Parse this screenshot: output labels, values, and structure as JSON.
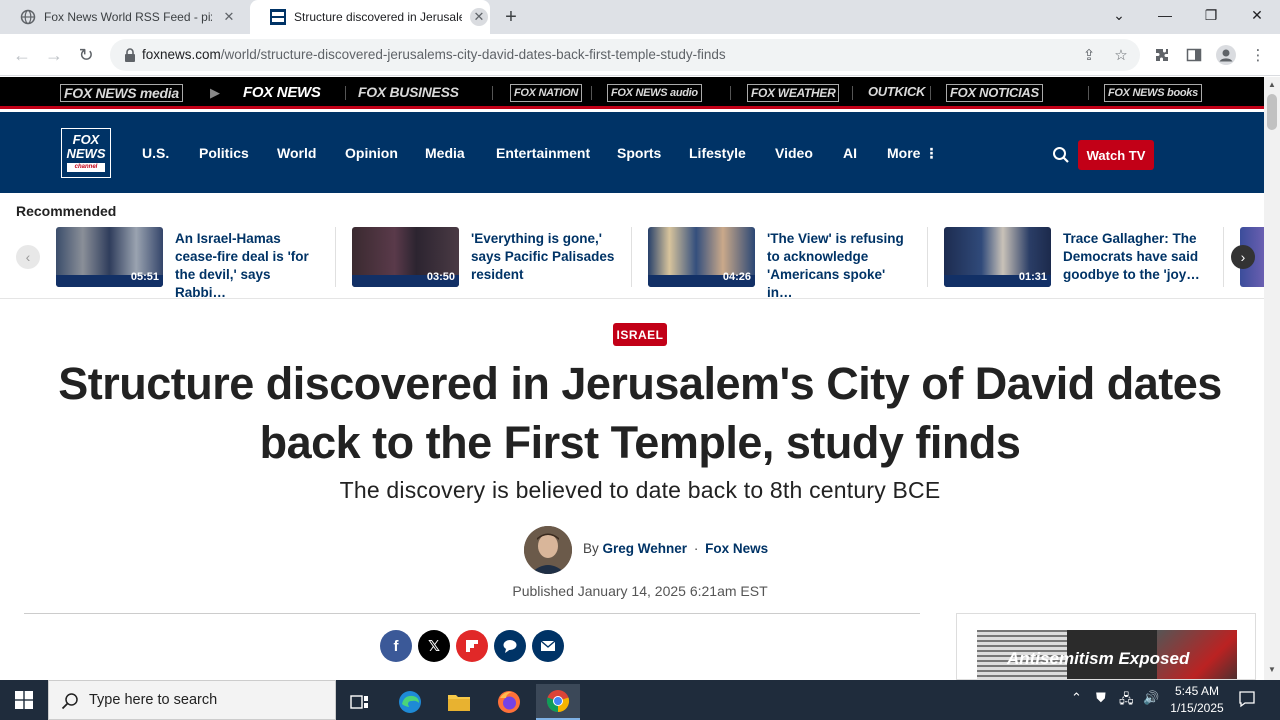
{
  "browser": {
    "tabs": [
      {
        "title": "Fox News World RSS Feed - pixm",
        "close": "✕"
      },
      {
        "title": "Structure discovered in Jerusalem",
        "close": "✕"
      }
    ],
    "new_tab": "+",
    "url_host": "foxnews.com",
    "url_path": "/world/structure-discovered-jerusalems-city-david-dates-back-first-temple-study-finds"
  },
  "brands": [
    "FOX NEWS media",
    "FOX NEWS",
    "FOX BUSINESS",
    "FOX NATION",
    "FOX NEWS audio",
    "FOX WEATHER",
    "OUTKICK",
    "FOX NOTICIAS",
    "FOX NEWS books"
  ],
  "logo": {
    "line1": "FOX",
    "line2": "NEWS",
    "line3": "channel"
  },
  "nav": {
    "items": [
      "U.S.",
      "Politics",
      "World",
      "Opinion",
      "Media",
      "Entertainment",
      "Sports",
      "Lifestyle",
      "Video",
      "AI",
      "More"
    ],
    "watch_tv": "Watch TV"
  },
  "recommended": {
    "title": "Recommended",
    "items": [
      {
        "duration": "05:51",
        "text": "An Israel-Hamas cease-fire deal is 'for the devil,' says Rabbi…"
      },
      {
        "duration": "03:50",
        "text": "'Everything is gone,' says Pacific Palisades resident"
      },
      {
        "duration": "04:26",
        "text": "'The View' is refusing to acknowledge 'Americans spoke' in…"
      },
      {
        "duration": "01:31",
        "text": "Trace Gallagher: The Democrats have said goodbye to the 'joy…"
      }
    ]
  },
  "article": {
    "badge": "ISRAEL",
    "headline": "Structure discovered in Jerusalem's City of David dates back to the First Temple, study finds",
    "subhead": "The discovery is believed to date back to 8th century BCE",
    "by": "By",
    "author": "Greg Wehner",
    "dot": "·",
    "outlet": "Fox News",
    "published": "Published January 14, 2025 6:21am EST"
  },
  "ad": {
    "text": "Antisemitism Exposed"
  },
  "taskbar": {
    "search_placeholder": "Type here to search",
    "time": "5:45 AM",
    "date": "1/15/2025"
  },
  "colors": {
    "fox_navy": "#003366",
    "fox_red": "#c20017"
  }
}
